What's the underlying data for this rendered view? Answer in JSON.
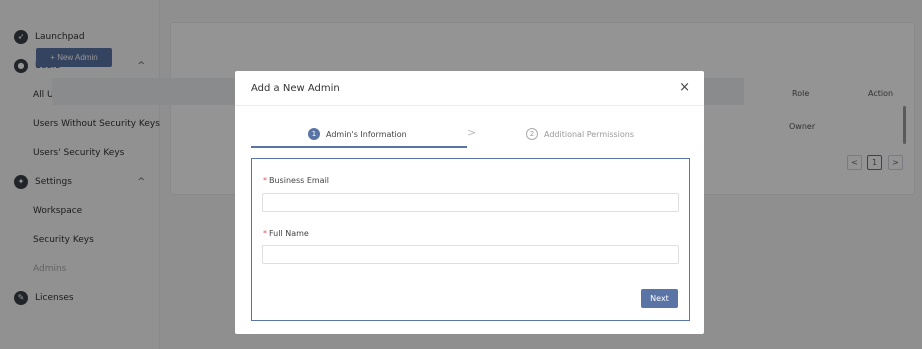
{
  "sidebar": {
    "launchpad": {
      "label": "Launchpad",
      "icon": "rocket-icon"
    },
    "users": {
      "label": "Users",
      "icon": "users-icon",
      "chevron": "^",
      "children": [
        "All Users",
        "Users Without Security Keys",
        "Users' Security Keys"
      ]
    },
    "settings": {
      "label": "Settings",
      "icon": "gear-icon",
      "chevron": "^",
      "children": [
        "Workspace",
        "Security Keys",
        "Admins"
      ]
    },
    "licenses": {
      "label": "Licenses",
      "icon": "license-icon"
    },
    "active_item": "Admins"
  },
  "main": {
    "new_admin_label": "+ New Admin",
    "table": {
      "headers": {
        "role": "Role",
        "action": "Action"
      },
      "rows": [
        {
          "role": "Owner"
        }
      ]
    },
    "pagination": {
      "prev": "<",
      "current": "1",
      "next": ">"
    }
  },
  "modal": {
    "title": "Add a New Admin",
    "close": "×",
    "steps": [
      {
        "num": "1",
        "label": "Admin's Information",
        "active": true
      },
      {
        "num": "2",
        "label": "Additional Permissions",
        "active": false
      }
    ],
    "step_separator": ">",
    "fields": [
      {
        "label": "Business Email",
        "required": "*",
        "value": "",
        "placeholder": ""
      },
      {
        "label": "Full Name",
        "required": "*",
        "value": "",
        "placeholder": ""
      }
    ],
    "next_label": "Next"
  },
  "colors": {
    "accent": "#5b74a6",
    "required": "#e05555",
    "overlay": "rgba(0,0,0,0.42)"
  }
}
